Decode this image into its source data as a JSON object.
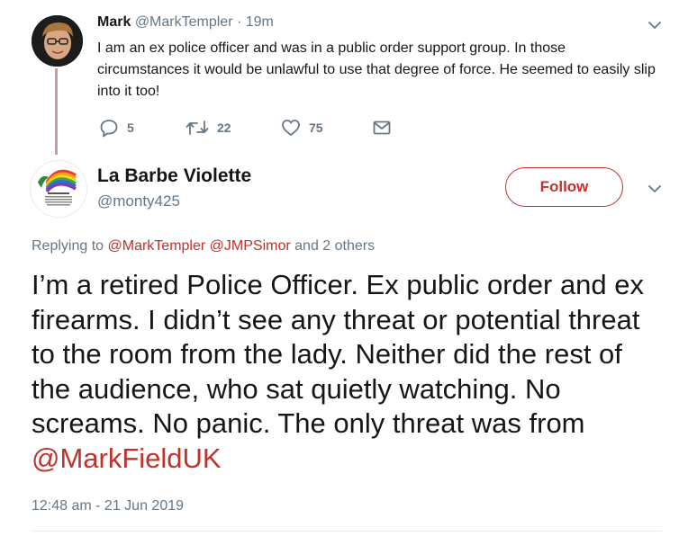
{
  "parent_tweet": {
    "author_name": "Mark",
    "handle": "@MarkTempler",
    "separator": "·",
    "time": "19m",
    "text": "I am an ex police officer and was in a public order support group. In those circumstances it would be unlawful to use that degree of force. He seemed to easily slip into it too!",
    "actions": {
      "replies": "5",
      "retweets": "22",
      "likes": "75"
    }
  },
  "main_tweet": {
    "author_name": "La Barbe Violette",
    "handle": "@monty425",
    "follow_label": "Follow",
    "replying": {
      "prefix": "Replying to",
      "mentions": [
        "@MarkTempler",
        "@JMPSimor"
      ],
      "suffix": "and 2 others"
    },
    "text_main": "I’m a retired Police Officer. Ex public order and ex firearms. I didn’t see any threat or potential threat to the room from the lady. Neither did the rest of the audience, who sat quietly watching. No screams. No panic. The only threat was from",
    "text_mention": "@MarkFieldUK",
    "timestamp": "12:48 am - 21 Jun 2019"
  },
  "colors": {
    "accent": "#c0322c",
    "text_primary": "#14171a",
    "text_secondary": "#657786",
    "thread_line": "#c79ba0"
  }
}
